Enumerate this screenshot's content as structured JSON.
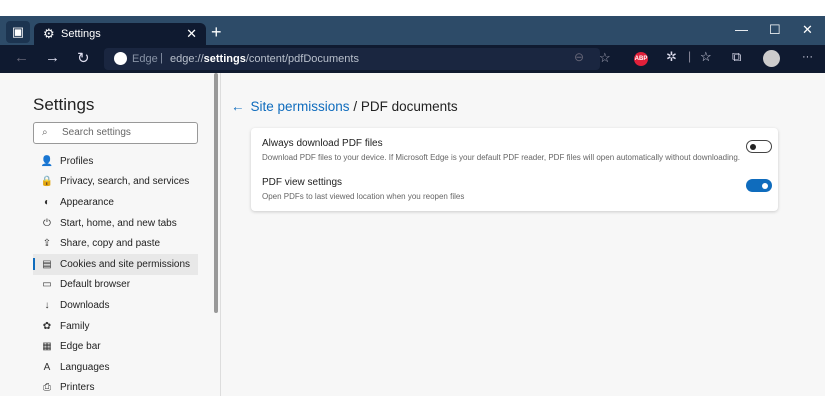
{
  "browser": {
    "tab_title": "Settings",
    "address_prefix": "Edge",
    "url_scheme": "edge://",
    "url_bold": "settings",
    "url_rest": "/content/pdfDocuments",
    "abp_label": "ABP"
  },
  "sidebar": {
    "title": "Settings",
    "search_placeholder": "Search settings",
    "items": [
      {
        "label": "Profiles",
        "icon": "👤"
      },
      {
        "label": "Privacy, search, and services",
        "icon": "🔒"
      },
      {
        "label": "Appearance",
        "icon": "◐"
      },
      {
        "label": "Start, home, and new tabs",
        "icon": "⏻"
      },
      {
        "label": "Share, copy and paste",
        "icon": "⇪"
      },
      {
        "label": "Cookies and site permissions",
        "icon": "▤",
        "active": true
      },
      {
        "label": "Default browser",
        "icon": "▭"
      },
      {
        "label": "Downloads",
        "icon": "↓"
      },
      {
        "label": "Family",
        "icon": "✿"
      },
      {
        "label": "Edge bar",
        "icon": "▦"
      },
      {
        "label": "Languages",
        "icon": "A"
      },
      {
        "label": "Printers",
        "icon": "⎙"
      }
    ]
  },
  "main": {
    "breadcrumb_parent": "Site permissions",
    "breadcrumb_sep": "/",
    "breadcrumb_current": "PDF documents",
    "settings": [
      {
        "title": "Always download PDF files",
        "description": "Download PDF files to your device. If Microsoft Edge is your default PDF reader, PDF files will open automatically without downloading.",
        "enabled": false
      },
      {
        "title": "PDF view settings",
        "description": "Open PDFs to last viewed location when you reopen files",
        "enabled": true
      }
    ]
  },
  "colors": {
    "accent": "#0f6cbd",
    "titlebar": "#2d4b68",
    "toolbar": "#0f1a30"
  }
}
